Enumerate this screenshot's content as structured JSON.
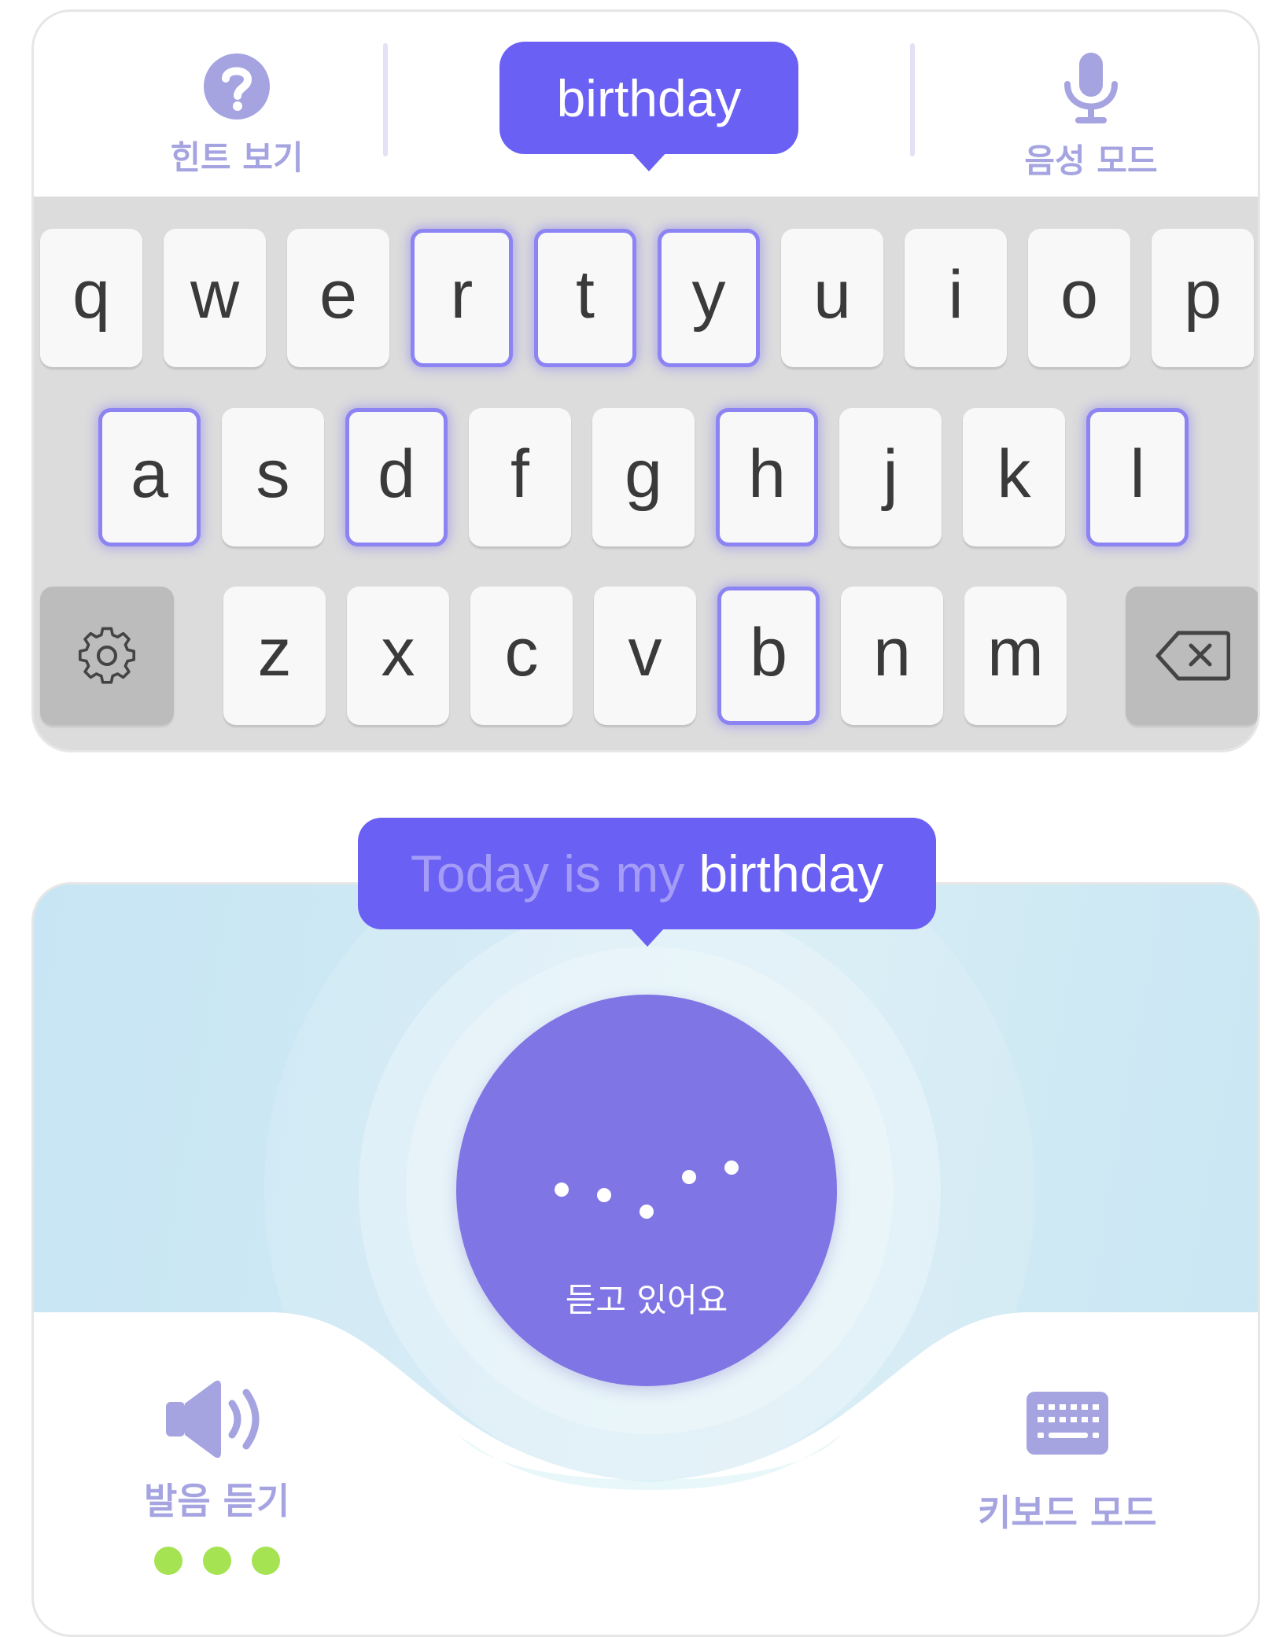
{
  "keyboard_view": {
    "hint_label": "힌트 보기",
    "voice_mode_label": "음성 모드",
    "target_word": "birthday",
    "rows": [
      [
        "q",
        "w",
        "e",
        "r",
        "t",
        "y",
        "u",
        "i",
        "o",
        "p"
      ],
      [
        "a",
        "s",
        "d",
        "f",
        "g",
        "h",
        "j",
        "k",
        "l"
      ],
      [
        "z",
        "x",
        "c",
        "v",
        "b",
        "n",
        "m"
      ]
    ],
    "highlighted_keys": [
      "r",
      "t",
      "y",
      "a",
      "d",
      "h",
      "l",
      "b"
    ],
    "settings_icon": "gear-icon",
    "backspace_icon": "backspace-icon"
  },
  "voice_view": {
    "sentence_prefix": "Today is my",
    "sentence_word": "birthday",
    "status": "듣고 있어요",
    "listen_label": "발음 듣기",
    "keyboard_mode_label": "키보드 모드",
    "listen_icon": "speaker-icon",
    "keyboard_icon": "keyboard-icon"
  },
  "colors": {
    "accent": "#6a60f4",
    "mic": "#8075e4",
    "label": "#a5a4e1",
    "key_highlight": "#8d84f4",
    "indicator_green": "#a6e352"
  }
}
